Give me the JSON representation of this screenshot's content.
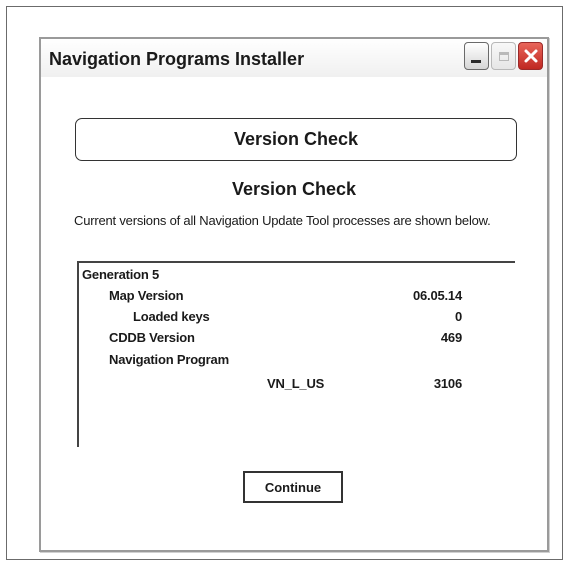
{
  "window": {
    "title": "Navigation Programs Installer",
    "controls": {
      "minimize_icon": "minimize-icon",
      "maximize_icon": "maximize-icon",
      "close_icon": "close-icon",
      "close_color": "#c8322a"
    }
  },
  "header": {
    "label": "Version Check"
  },
  "subheading": "Version Check",
  "description": "Current versions of all Navigation Update Tool processes are shown below.",
  "versions": {
    "group": "Generation 5",
    "map_version": {
      "label": "Map Version",
      "value": "06.05.14"
    },
    "loaded_keys": {
      "label": "Loaded keys",
      "value": "0"
    },
    "cddb_version": {
      "label": "CDDB Version",
      "value": "469"
    },
    "navigation_program": {
      "label": "Navigation Program",
      "name": "VN_L_US",
      "value": "3106"
    }
  },
  "continue_button": {
    "label": "Continue"
  }
}
